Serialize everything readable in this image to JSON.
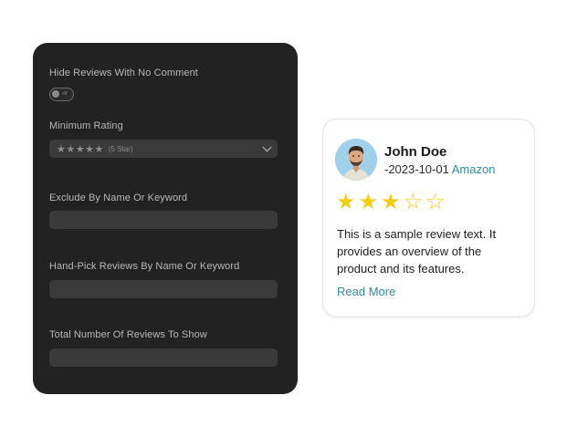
{
  "settings": {
    "hide_no_comment_label": "Hide Reviews With No Comment",
    "hide_no_comment_toggle_state": "off",
    "min_rating_label": "Minimum Rating",
    "min_rating_stars": "★★★★★",
    "min_rating_value": "(5 Star)",
    "exclude_label": "Exclude By Name Or Keyword",
    "exclude_value": "",
    "handpick_label": "Hand-Pick Reviews By Name Or Keyword",
    "handpick_value": "",
    "total_label": "Total Number Of Reviews To Show",
    "total_value": ""
  },
  "review": {
    "name": "John Doe",
    "date": "-2023-10-01",
    "source": "Amazon",
    "rating": 3,
    "max_rating": 5,
    "text": "This is a sample review text. It provides an overview of the product and its features.",
    "read_more": "Read More"
  },
  "colors": {
    "panel_bg": "#222222",
    "field_bg": "#3a3a3a",
    "star": "#f3cf16",
    "link": "#2f8aa3"
  }
}
